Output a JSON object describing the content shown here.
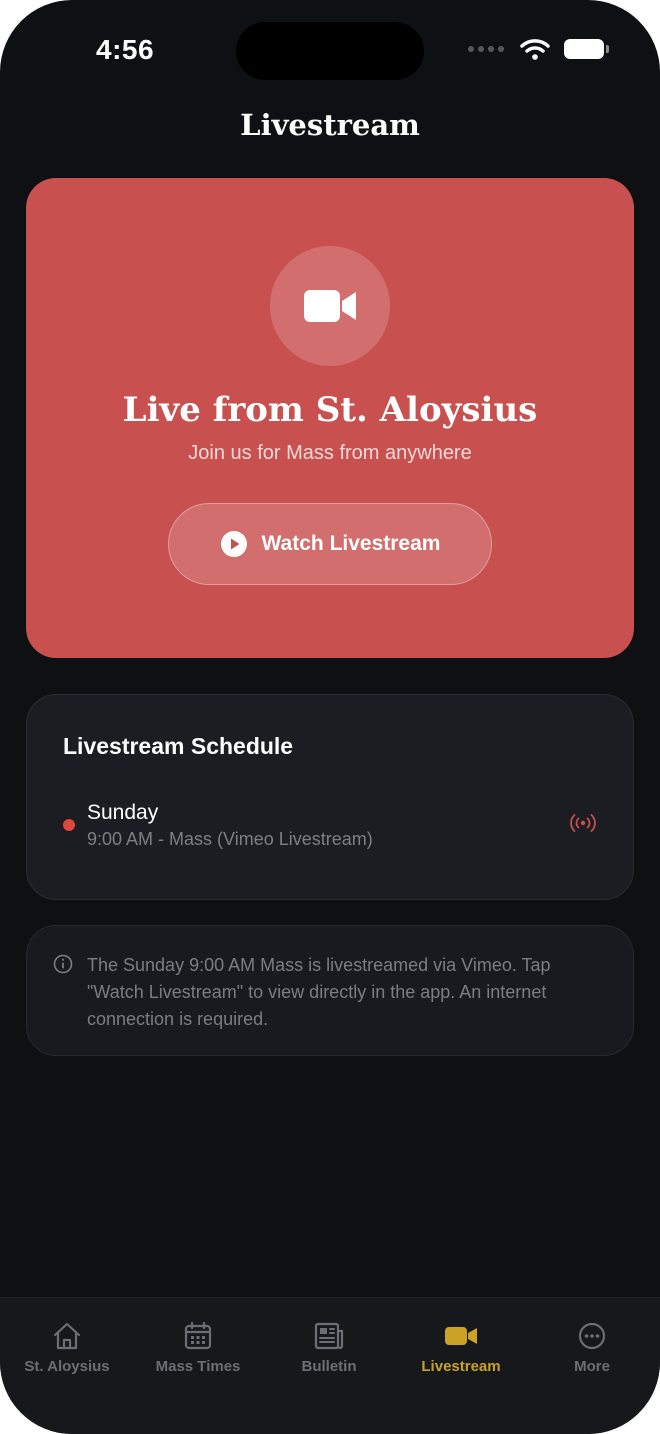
{
  "status_bar": {
    "time": "4:56"
  },
  "header": {
    "title": "Livestream"
  },
  "hero": {
    "icon": "video-camera-icon",
    "title": "Live from St. Aloysius",
    "subtitle": "Join us for Mass from anywhere",
    "button_label": "Watch Livestream",
    "button_icon": "play-circle-icon"
  },
  "schedule": {
    "title": "Livestream Schedule",
    "items": [
      {
        "day": "Sunday",
        "detail": "9:00 AM - Mass (Vimeo Livestream)",
        "icon": "broadcast-icon"
      }
    ]
  },
  "info": {
    "icon": "info-circle-icon",
    "text": "The Sunday 9:00 AM Mass is livestreamed via Vimeo. Tap \"Watch Livestream\" to view directly in the app. An internet connection is required."
  },
  "tabs": [
    {
      "label": "St. Aloysius",
      "icon": "home-icon",
      "active": false
    },
    {
      "label": "Mass Times",
      "icon": "calendar-icon",
      "active": false
    },
    {
      "label": "Bulletin",
      "icon": "newspaper-icon",
      "active": false
    },
    {
      "label": "Livestream",
      "icon": "video-camera-icon",
      "active": true
    },
    {
      "label": "More",
      "icon": "more-circle-icon",
      "active": false
    }
  ],
  "colors": {
    "accent": "#c9a227",
    "hero": "#c8504f",
    "live": "#e0453e",
    "background": "#0e1014"
  }
}
